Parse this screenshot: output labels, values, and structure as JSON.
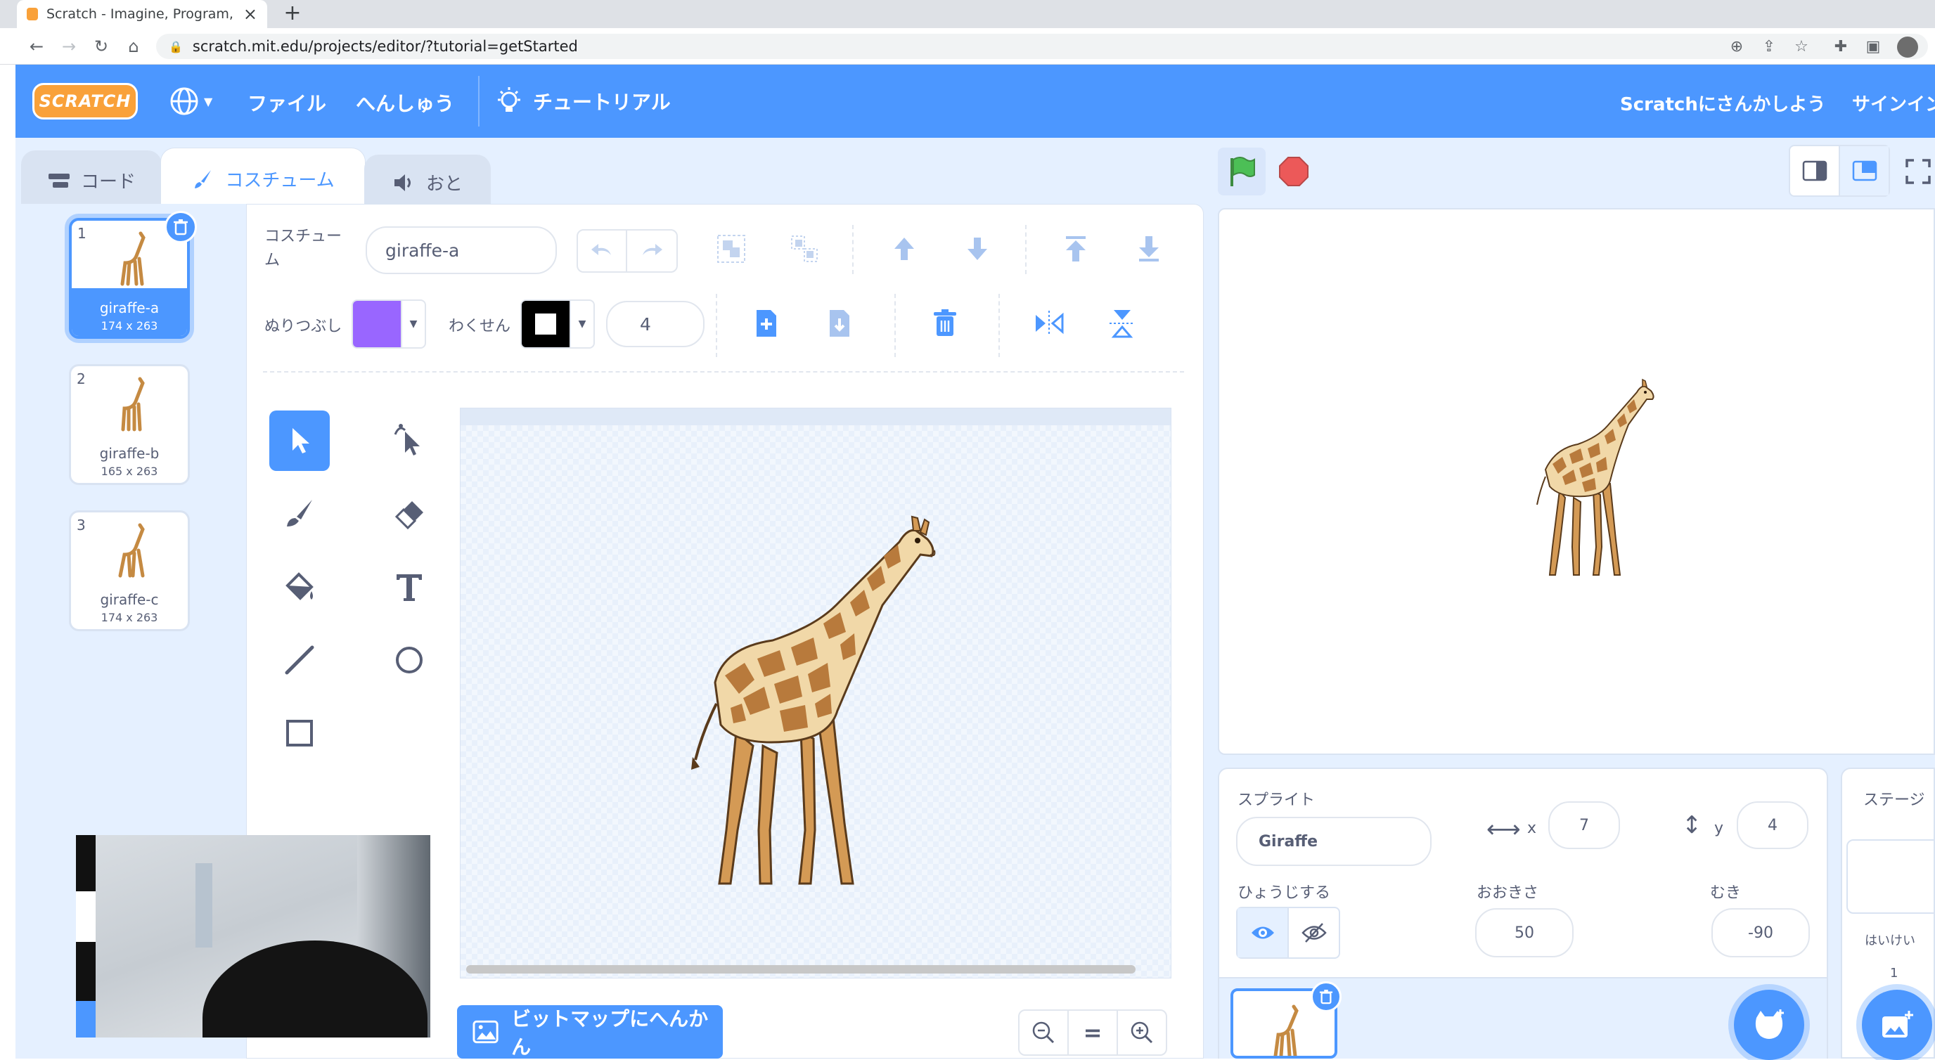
{
  "browser": {
    "tab_title": "Scratch - Imagine, Program, Sh",
    "tab_close": "×",
    "new_tab": "+",
    "url": "scratch.mit.edu/projects/editor/?tutorial=getStarted"
  },
  "menubar": {
    "logo_text": "SCRATCH",
    "file": "ファイル",
    "edit": "へんしゅう",
    "tutorial": "チュートリアル",
    "join": "Scratchにさんかしよう",
    "signin": "サインイン"
  },
  "editor_tabs": {
    "code": "コード",
    "costume": "コスチューム",
    "sound": "おと"
  },
  "costumes": [
    {
      "num": "1",
      "name": "giraffe-a",
      "size": "174 x 263"
    },
    {
      "num": "2",
      "name": "giraffe-b",
      "size": "165 x 263"
    },
    {
      "num": "3",
      "name": "giraffe-c",
      "size": "174 x 263"
    }
  ],
  "paint": {
    "costume_label": "コスチューム",
    "costume_name": "giraffe-a",
    "fill_label": "ぬりつぶし",
    "fill_color": "#9966ff",
    "outline_label": "わくせん",
    "outline_color": "#000000",
    "outline_width": "4",
    "convert_button": "ビットマップにへんかん",
    "zoom_reset": "="
  },
  "sprite_info": {
    "title": "スプライト",
    "name": "Giraffe",
    "x_label": "x",
    "x": "7",
    "y_label": "y",
    "y": "4",
    "show_label": "ひょうじする",
    "size_label": "おおきさ",
    "size": "50",
    "direction_label": "むき",
    "direction": "-90"
  },
  "stage_panel": {
    "title": "ステージ",
    "backdrops_label": "はいけい",
    "backdrops_count": "1"
  },
  "colors": {
    "scratch_blue": "#4c97ff",
    "editor_bg": "#e5f0ff",
    "text_gray": "#575e75",
    "green_flag": "#4cbf56",
    "stop": "#ec5959"
  }
}
